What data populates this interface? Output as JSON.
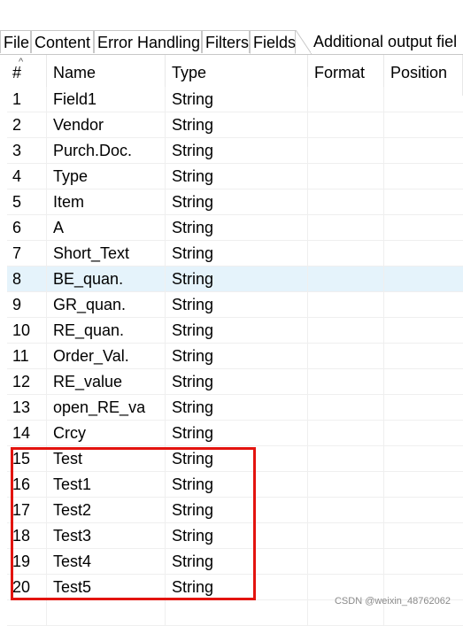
{
  "tabs": [
    {
      "label": "File",
      "active": false
    },
    {
      "label": "Content",
      "active": false
    },
    {
      "label": "Error Handling",
      "active": false
    },
    {
      "label": "Filters",
      "active": false
    },
    {
      "label": "Fields",
      "active": true
    },
    {
      "label": "Additional output fiel",
      "active": false
    }
  ],
  "columns": {
    "num": "#",
    "name": "Name",
    "type": "Type",
    "format": "Format",
    "position": "Position"
  },
  "rows": [
    {
      "num": "1",
      "name": "Field1",
      "type": "String"
    },
    {
      "num": "2",
      "name": "Vendor",
      "type": "String"
    },
    {
      "num": "3",
      "name": "Purch.Doc.",
      "type": "String"
    },
    {
      "num": "4",
      "name": "Type",
      "type": "String"
    },
    {
      "num": "5",
      "name": "Item",
      "type": "String"
    },
    {
      "num": "6",
      "name": "A",
      "type": "String"
    },
    {
      "num": "7",
      "name": "Short_Text",
      "type": "String"
    },
    {
      "num": "8",
      "name": "BE_quan.",
      "type": "String"
    },
    {
      "num": "9",
      "name": "GR_quan.",
      "type": "String"
    },
    {
      "num": "10",
      "name": "RE_quan.",
      "type": "String"
    },
    {
      "num": "11",
      "name": "Order_Val.",
      "type": "String"
    },
    {
      "num": "12",
      "name": "RE_value",
      "type": "String"
    },
    {
      "num": "13",
      "name": "open_RE_va",
      "type": "String"
    },
    {
      "num": "14",
      "name": "Crcy",
      "type": "String"
    },
    {
      "num": "15",
      "name": "Test",
      "type": "String"
    },
    {
      "num": "16",
      "name": "Test1",
      "type": "String"
    },
    {
      "num": "17",
      "name": "Test2",
      "type": "String"
    },
    {
      "num": "18",
      "name": "Test3",
      "type": "String"
    },
    {
      "num": "19",
      "name": "Test4",
      "type": "String"
    },
    {
      "num": "20",
      "name": "Test5",
      "type": "String"
    }
  ],
  "selected_row": "8",
  "colors": {
    "selection": "#e5f3fb",
    "highlight": "#e3140f"
  },
  "watermark": "CSDN @weixin_48762062"
}
